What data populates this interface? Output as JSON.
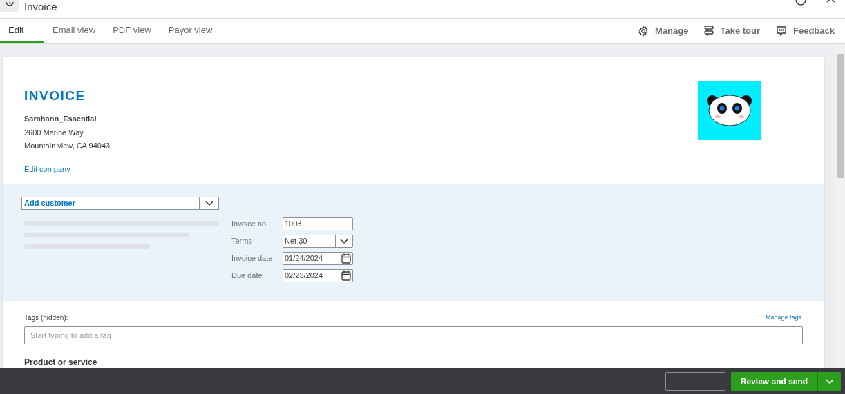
{
  "window": {
    "title": "Invoice"
  },
  "tabs": [
    {
      "label": "Edit",
      "selected": true
    },
    {
      "label": "Email view",
      "selected": false
    },
    {
      "label": "PDF view",
      "selected": false
    },
    {
      "label": "Payor view",
      "selected": false
    }
  ],
  "toolbar": [
    {
      "kind": "gear",
      "label": "Manage"
    },
    {
      "kind": "signpost",
      "label": "Take tour"
    },
    {
      "kind": "chat",
      "label": "Feedback"
    }
  ],
  "invoice": {
    "heading": "INVOICE",
    "company": "Sarahann_Essential",
    "address_lines": [
      "2600 Marine Way",
      "Mountain view, CA 94043"
    ],
    "edit_link": "Edit company",
    "logo": {
      "kind": "picture"
    }
  },
  "customer": {
    "value": "Add customer"
  },
  "fields": [
    {
      "kind": "text",
      "label": "Invoice no.",
      "value": "1003"
    },
    {
      "kind": "select",
      "label": "Terms",
      "value": "Net 30"
    },
    {
      "kind": "date",
      "label": "Invoice date",
      "value": "01/24/2024"
    },
    {
      "kind": "date",
      "label": "Due date",
      "value": "02/23/2024"
    }
  ],
  "tags": {
    "label": "Tags (hidden):",
    "manage_link": "Manage tags",
    "placeholder": "Start typing to add a tag"
  },
  "section_heading": "Product or service",
  "footer": {
    "primary": "Review and send"
  }
}
